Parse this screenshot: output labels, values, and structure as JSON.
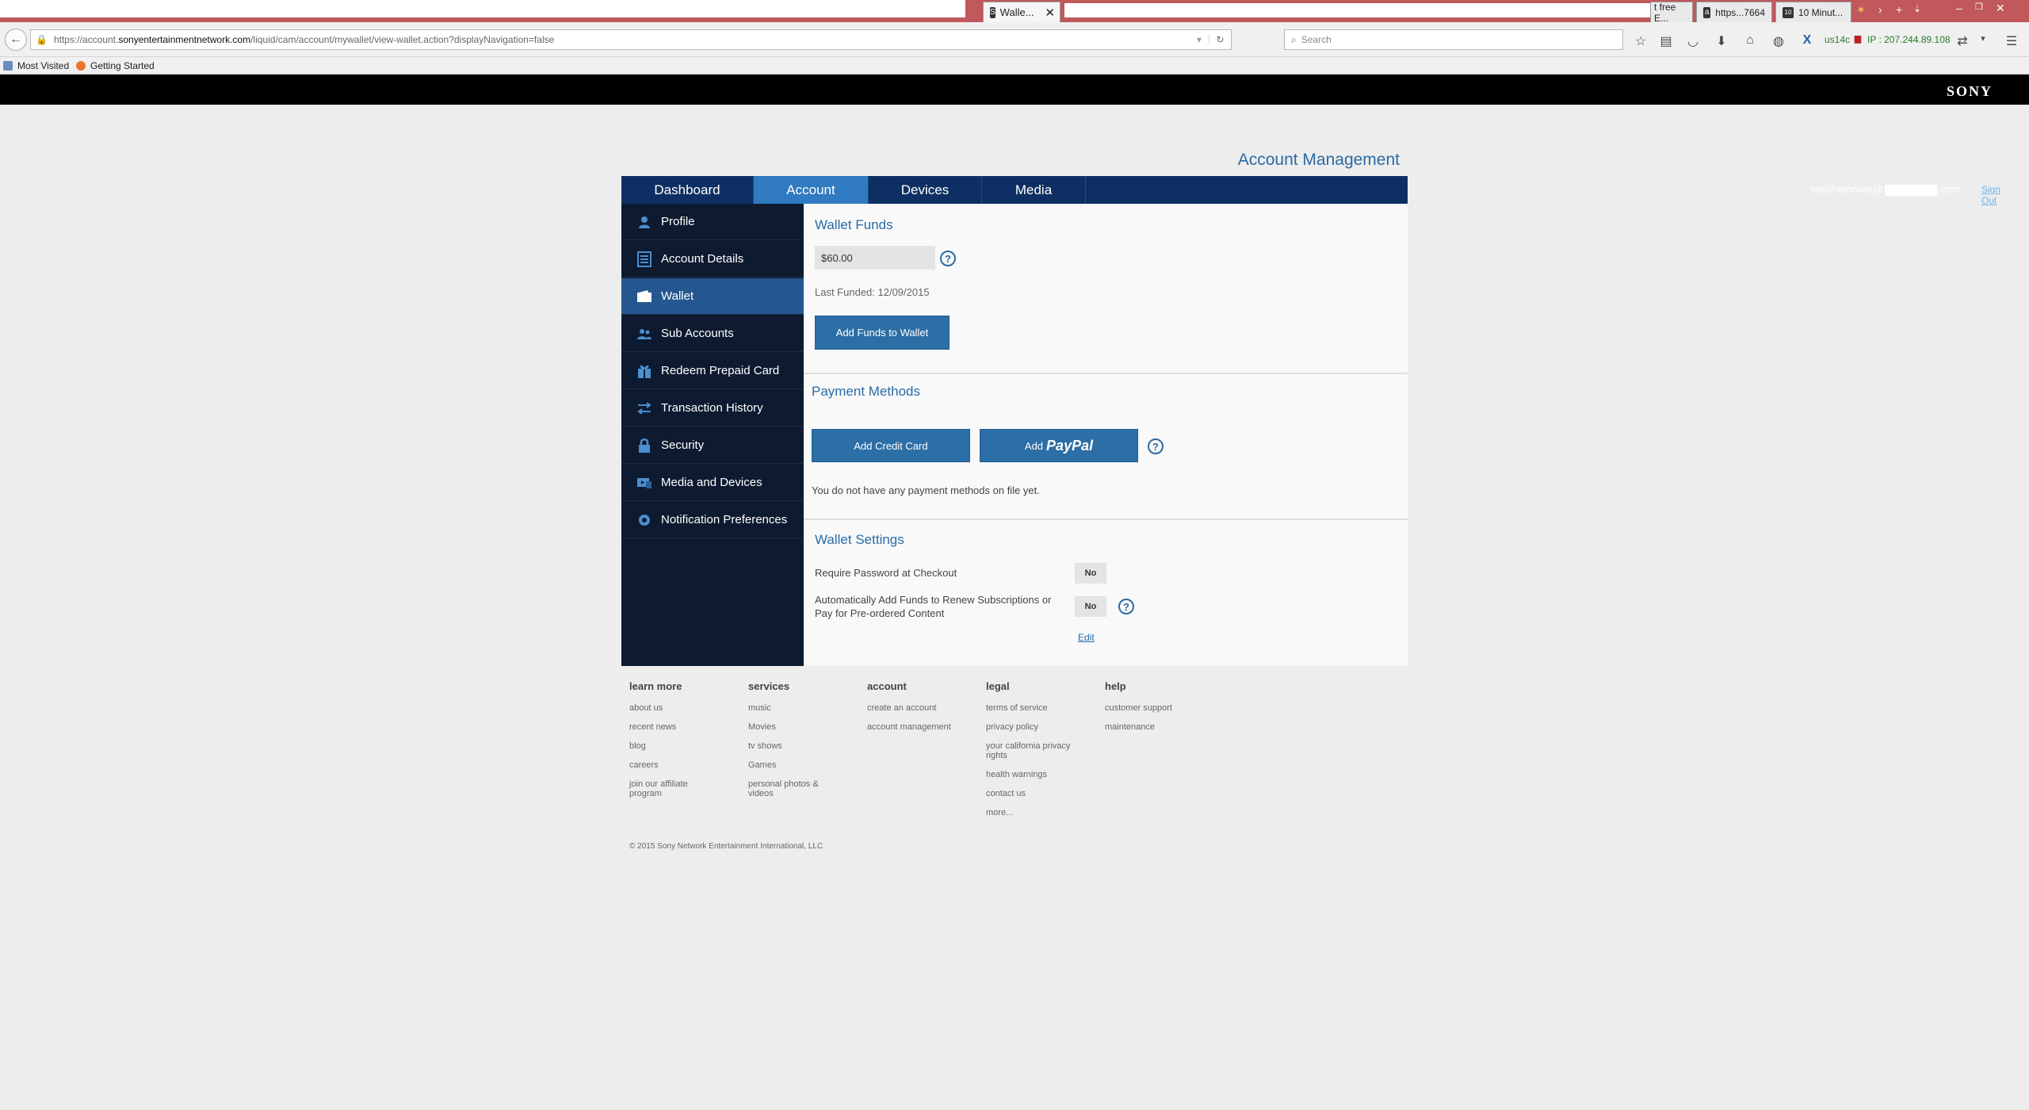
{
  "browser": {
    "tabs": [
      {
        "label": "Walle...",
        "favicon": "S"
      },
      {
        "label": "t free E...",
        "favicon": ""
      },
      {
        "label": "https...7664",
        "favicon": "a"
      },
      {
        "label": "10 Minut...",
        "favicon": "10"
      }
    ],
    "url_prefix": "https://account.",
    "url_domain": "sonyentertainmentnetwork.com",
    "url_suffix": "/liquid/cam/account/mywallet/view-wallet.action?displayNavigation=false",
    "search_placeholder": "Search",
    "vpn_label": "us14c",
    "ip_label": "IP : 207.244.89.108",
    "bookmarks": [
      "Most Visited",
      "Getting Started"
    ]
  },
  "header": {
    "brand": "SONY",
    "page_title": "Account Management"
  },
  "main_tabs": [
    "Dashboard",
    "Account",
    "Devices",
    "Media"
  ],
  "active_tab": "Account",
  "user": {
    "email_prefix": "tanishamoore@",
    "email_suffix": ".com",
    "sign_out": "Sign Out"
  },
  "sidebar": {
    "items": [
      {
        "label": "Profile",
        "icon": "user-icon"
      },
      {
        "label": "Account Details",
        "icon": "document-icon"
      },
      {
        "label": "Wallet",
        "icon": "wallet-icon"
      },
      {
        "label": "Sub Accounts",
        "icon": "users-icon"
      },
      {
        "label": "Redeem Prepaid Card",
        "icon": "gift-icon"
      },
      {
        "label": "Transaction History",
        "icon": "arrows-icon"
      },
      {
        "label": "Security",
        "icon": "lock-icon"
      },
      {
        "label": "Media and Devices",
        "icon": "media-icon"
      },
      {
        "label": "Notification Preferences",
        "icon": "gear-icon"
      }
    ],
    "active": "Wallet"
  },
  "wallet_funds": {
    "title": "Wallet Funds",
    "amount": "$60.00",
    "last_funded": "Last Funded: 12/09/2015",
    "add_funds_button": "Add Funds to Wallet"
  },
  "payment_methods": {
    "title": "Payment Methods",
    "add_credit_card": "Add Credit Card",
    "add_paypal_prefix": "Add",
    "paypal_brand": "PayPal",
    "empty_message": "You do not have any payment methods on file yet."
  },
  "wallet_settings": {
    "title": "Wallet Settings",
    "require_password_label": "Require Password at Checkout",
    "require_password_value": "No",
    "auto_add_label_line1": "Automatically Add Funds to Renew Subscriptions or",
    "auto_add_label_line2": "Pay for Pre-ordered Content",
    "auto_add_value": "No",
    "edit_link": "Edit"
  },
  "footer": {
    "columns": [
      {
        "heading": "learn more",
        "links": [
          "about us",
          "recent news",
          "blog",
          "careers",
          "join our affiliate program"
        ]
      },
      {
        "heading": "services",
        "links": [
          "music",
          "Movies",
          "tv shows",
          "Games",
          "personal photos & videos"
        ]
      },
      {
        "heading": "account",
        "links": [
          "create an account",
          "account management"
        ]
      },
      {
        "heading": "legal",
        "links": [
          "terms of service",
          "privacy policy",
          "your california privacy rights",
          "health warnings",
          "contact us",
          "more..."
        ]
      },
      {
        "heading": "help",
        "links": [
          "customer support",
          "maintenance"
        ]
      }
    ],
    "copyright": "© 2015 Sony Network Entertainment International, LLC"
  },
  "colors": {
    "accent": "#2b6aa6",
    "nav_bg": "#0e2f63",
    "sidebar_bg": "#0d1a30",
    "sidebar_active": "#24578f",
    "button_bg": "#2c6ea6"
  }
}
